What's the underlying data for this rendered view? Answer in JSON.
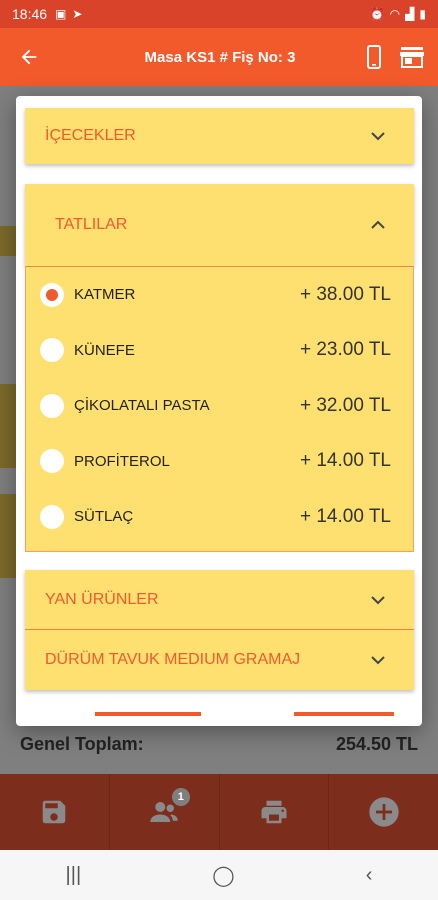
{
  "status_bar": {
    "time": "18:46",
    "icons_left": [
      "image-icon",
      "send-icon"
    ],
    "icons_right": [
      "alarm-icon",
      "wifi-icon",
      "signal-icon",
      "battery-icon"
    ]
  },
  "app_bar": {
    "title": "Masa KS1 # Fiş No: 3"
  },
  "background": {
    "total_label": "Genel Toplam:",
    "total_value": "254.50 TL",
    "badge_count": "1"
  },
  "dialog": {
    "sections": [
      {
        "id": "icecekler",
        "label": "İÇECEKLER",
        "expanded": false
      },
      {
        "id": "tatlilar",
        "label": "TATLILAR",
        "expanded": true
      },
      {
        "id": "yan-urunler",
        "label": "YAN ÜRÜNLER",
        "expanded": false
      },
      {
        "id": "durum",
        "label": "DÜRÜM TAVUK MEDIUM GRAMAJ",
        "expanded": false
      }
    ],
    "options": [
      {
        "name": "KATMER",
        "price": "+ 38.00 TL",
        "selected": true
      },
      {
        "name": "KÜNEFE",
        "price": "+ 23.00 TL",
        "selected": false
      },
      {
        "name": "ÇİKOLATALI PASTA",
        "price": "+ 32.00 TL",
        "selected": false
      },
      {
        "name": "PROFİTEROL",
        "price": "+ 14.00 TL",
        "selected": false
      },
      {
        "name": "SÜTLAÇ",
        "price": "+ 14.00 TL",
        "selected": false
      }
    ]
  },
  "colors": {
    "accent": "#f25a2c",
    "panel": "#fde070"
  }
}
